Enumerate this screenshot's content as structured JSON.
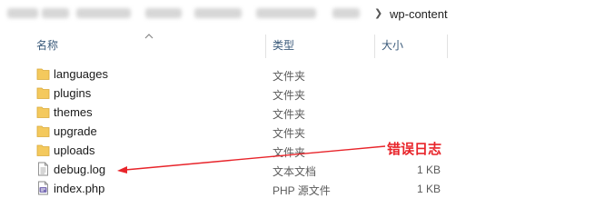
{
  "breadcrumb": {
    "current": "wp-content",
    "arrow_icon": "chevron-right-icon"
  },
  "columns": {
    "name": "名称",
    "type": "类型",
    "size": "大小"
  },
  "files": [
    {
      "name": "languages",
      "type": "文件夹",
      "size": "",
      "icon": "folder-icon"
    },
    {
      "name": "plugins",
      "type": "文件夹",
      "size": "",
      "icon": "folder-icon"
    },
    {
      "name": "themes",
      "type": "文件夹",
      "size": "",
      "icon": "folder-icon"
    },
    {
      "name": "upgrade",
      "type": "文件夹",
      "size": "",
      "icon": "folder-icon"
    },
    {
      "name": "uploads",
      "type": "文件夹",
      "size": "",
      "icon": "folder-icon"
    },
    {
      "name": "debug.log",
      "type": "文本文档",
      "size": "1 KB",
      "icon": "text-file-icon"
    },
    {
      "name": "index.php",
      "type": "PHP 源文件",
      "size": "1 KB",
      "icon": "php-file-icon"
    }
  ],
  "annotation": {
    "label": "错误日志",
    "color": "#e8242a"
  },
  "colors": {
    "folder": "#f4c95d",
    "header_text": "#3a5a7a"
  }
}
